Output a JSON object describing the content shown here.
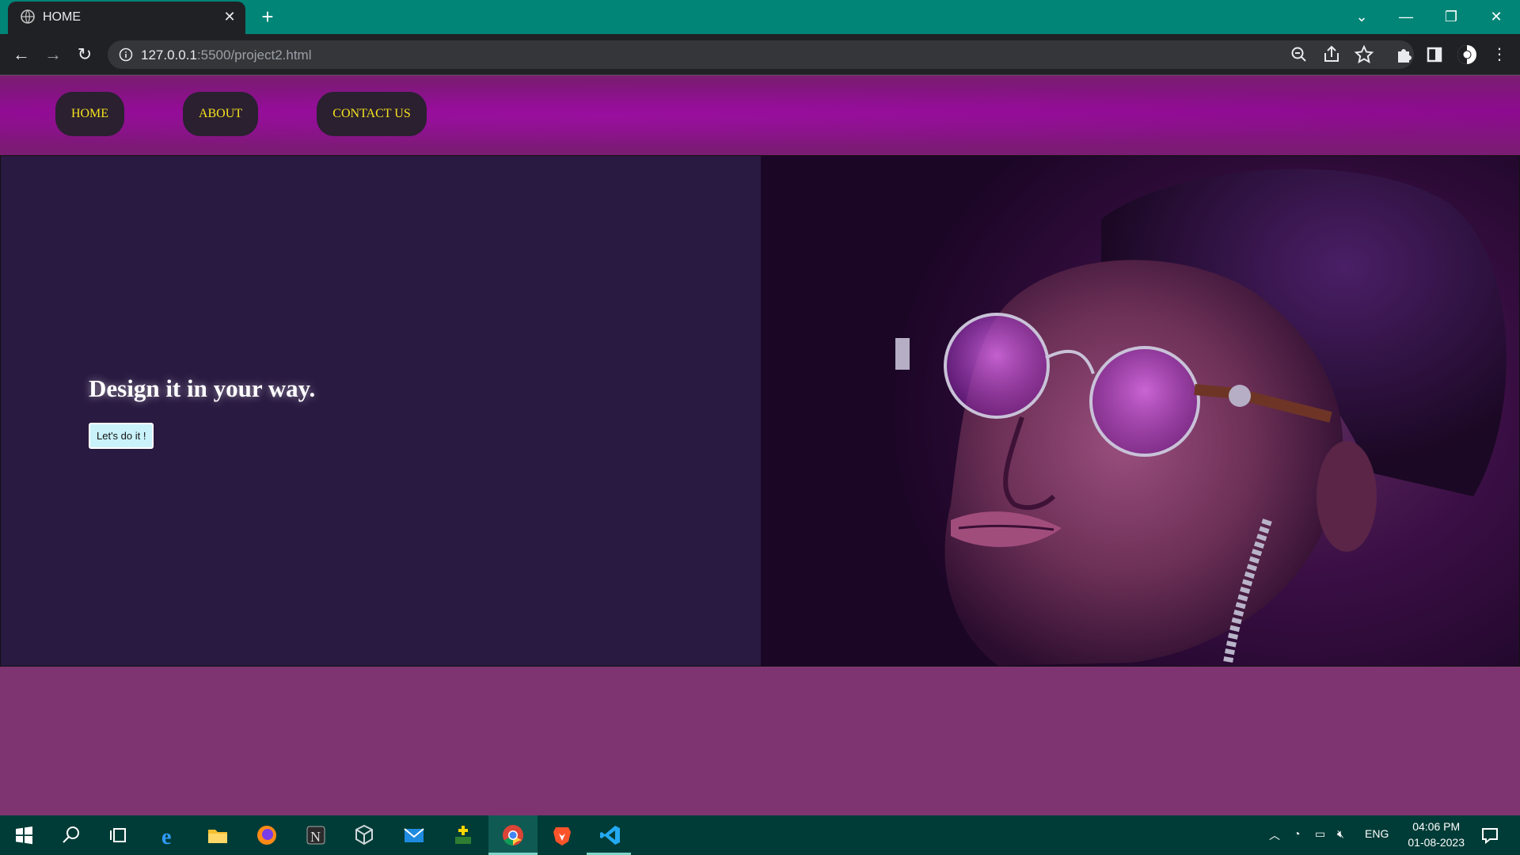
{
  "browser": {
    "tab_title": "HOME",
    "url_host": "127.0.0.1",
    "url_rest": ":5500/project2.html"
  },
  "nav": {
    "home": "HOME",
    "about": "ABOUT",
    "contact": "CONTACT US"
  },
  "hero": {
    "headline": "Design it in your way.",
    "cta_label": "Let's do it !"
  },
  "taskbar": {
    "language": "ENG",
    "time": "04:06 PM",
    "date": "01-08-2023"
  },
  "colors": {
    "tabstrip": "#008577",
    "navbar": "#8d0a8f",
    "hero_bg": "#291a41",
    "page_bg": "#7e3470",
    "nav_text": "#f6e31c"
  }
}
